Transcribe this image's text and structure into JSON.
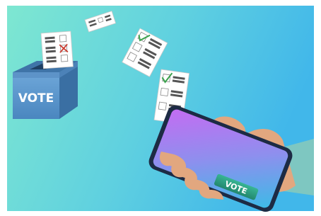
{
  "ballot_box": {
    "label": "VOTE"
  },
  "phone": {
    "button_label": "VOTE"
  },
  "ballots": [
    {
      "mark": "cross"
    },
    {
      "mark": "blank"
    },
    {
      "mark": "check"
    },
    {
      "mark": "check"
    }
  ],
  "colors": {
    "background_left": "#7fe3cf",
    "background_right": "#3db8e8",
    "box_front": "#5b95c9",
    "box_top": "#4a7fb4",
    "screen_start": "#b57af0",
    "screen_end": "#4bb3e6",
    "vote_button": "#2fa98a",
    "check_mark": "#3aa14b",
    "cross_mark": "#cc3b2f",
    "skin": "#e2a77f",
    "sleeve": "#7ec7c1"
  }
}
